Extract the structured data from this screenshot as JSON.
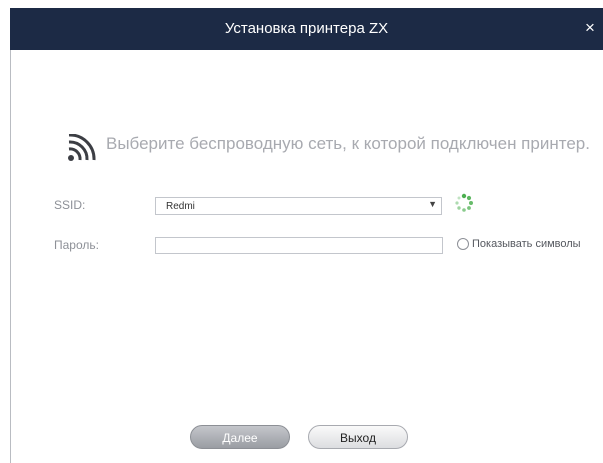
{
  "window": {
    "title": "Установка принтера ZX",
    "close_glyph": "×"
  },
  "main": {
    "heading": "Выберите беспроводную сеть, к которой подключен принтер.",
    "heading_icon": "wifi-signal-icon"
  },
  "form": {
    "ssid_label": "SSID:",
    "ssid_value": "Redmi",
    "ssid_arrow": "▼",
    "password_label": "Пароль:",
    "password_value": "",
    "show_chars_label": "Показывать символы",
    "show_chars_checked": false,
    "loading_icon": "loading-spinner-icon"
  },
  "buttons": {
    "next_label": "Далее",
    "next_enabled": false,
    "exit_label": "Выход"
  },
  "colors": {
    "titlebar": "#1c2a45",
    "spinner": "#4caf50"
  }
}
